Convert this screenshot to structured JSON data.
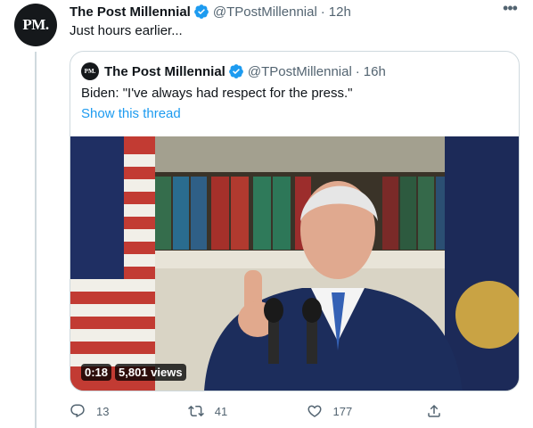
{
  "tweet": {
    "avatar_text": "PM.",
    "author_name": "The Post Millennial",
    "author_handle": "@TPostMillennial",
    "separator": "·",
    "time": "12h",
    "more_label": "•••",
    "text": "Just hours earlier...",
    "verified_color": "#1d9bf0"
  },
  "quoted_tweet": {
    "avatar_text": "PM.",
    "author_name": "The Post Millennial",
    "author_handle": "@TPostMillennial",
    "separator": "·",
    "time": "16h",
    "text": "Biden: \"I've always had respect for the press.\"",
    "show_thread_label": "Show this thread",
    "video": {
      "duration": "0:18",
      "views": "5,801 views"
    }
  },
  "actions": {
    "replies": "13",
    "retweets": "41",
    "likes": "177",
    "share_icon": "share-icon"
  },
  "colors": {
    "accent": "#1d9bf0",
    "muted": "#536471",
    "border": "#cfd9de"
  }
}
